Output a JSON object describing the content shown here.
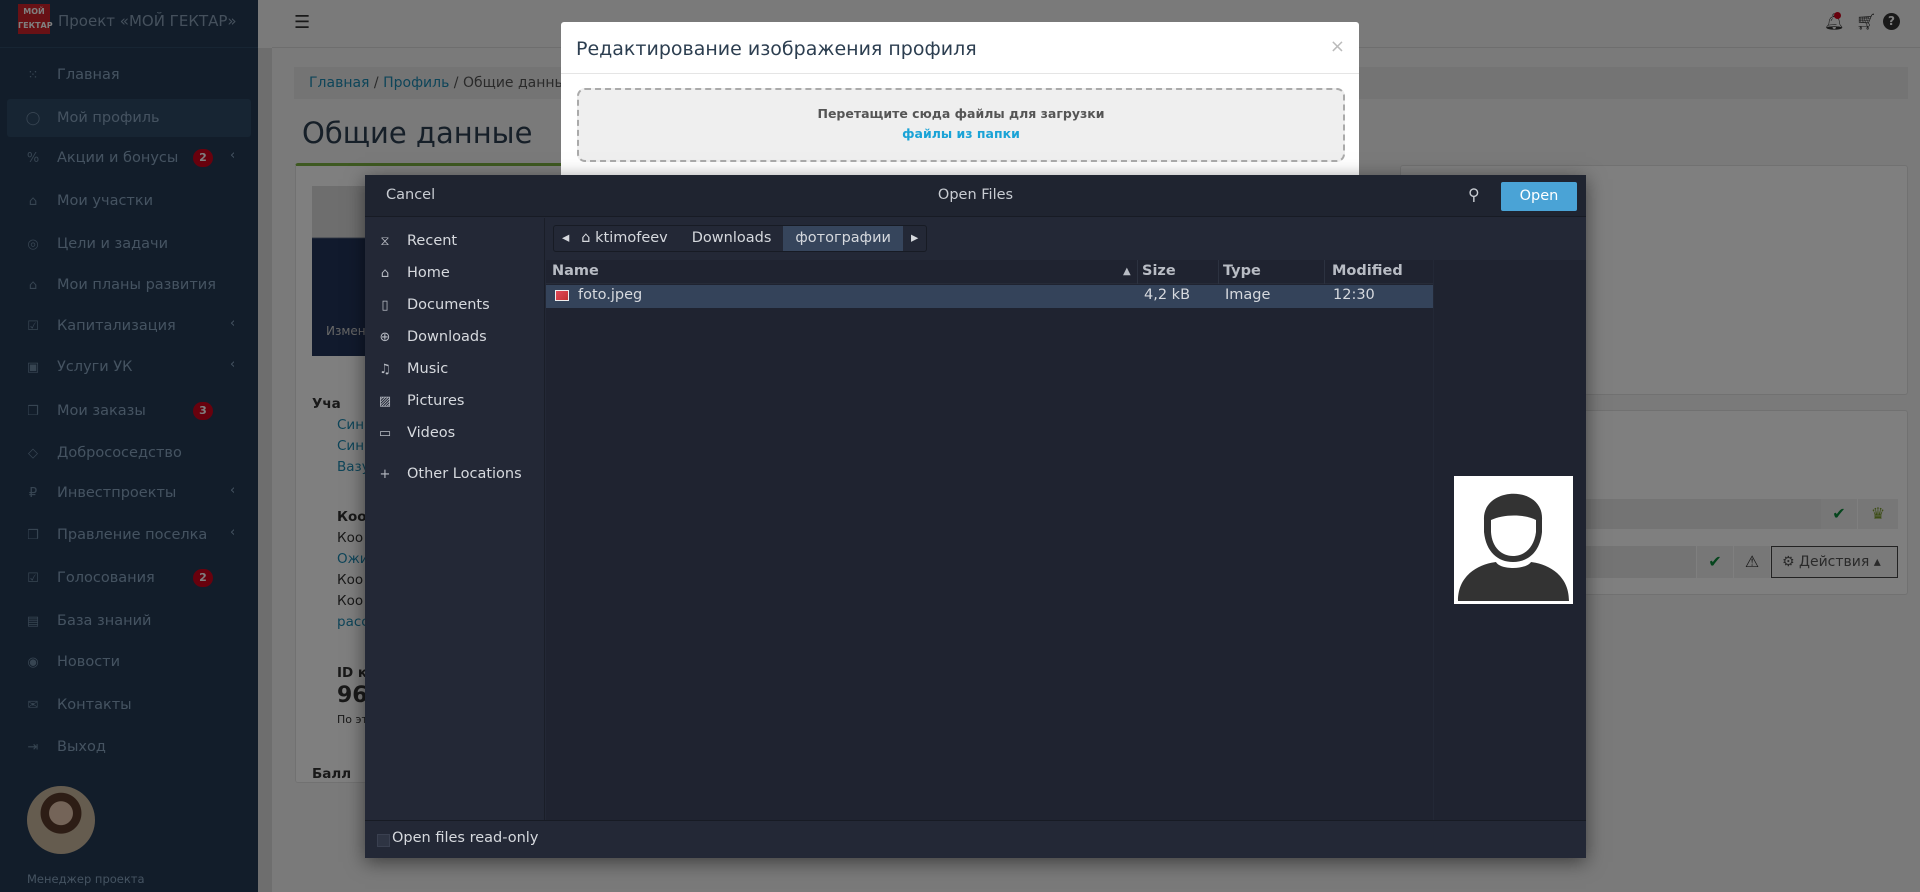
{
  "sidebar": {
    "logo_text": "МОЙ ГЕКТАР",
    "project_title": "Проект «МОЙ ГЕКТАР»",
    "items": [
      {
        "label": "Главная",
        "icon": "grid-icon"
      },
      {
        "label": "Мой профиль",
        "icon": "user-circle-icon",
        "active": true
      },
      {
        "label": "Акции и бонусы",
        "icon": "percent-icon",
        "badge": "2",
        "expandable": true
      },
      {
        "label": "Мои участки",
        "icon": "land-icon"
      },
      {
        "label": "Цели и задачи",
        "icon": "target-icon"
      },
      {
        "label": "Мои планы развития",
        "icon": "plan-icon"
      },
      {
        "label": "Капитализация",
        "icon": "chart-check-icon",
        "expandable": true
      },
      {
        "label": "Услуги УК",
        "icon": "briefcase-icon",
        "expandable": true
      },
      {
        "label": "Мои заказы",
        "icon": "boxes-icon",
        "badge": "3"
      },
      {
        "label": "Добрососедство",
        "icon": "handshake-icon"
      },
      {
        "label": "Инвестпроекты",
        "icon": "ruble-icon",
        "expandable": true
      },
      {
        "label": "Правление поселка",
        "icon": "boxes-icon",
        "expandable": true
      },
      {
        "label": "Голосования",
        "icon": "vote-icon",
        "badge": "2"
      },
      {
        "label": "База знаний",
        "icon": "book-icon"
      },
      {
        "label": "Новости",
        "icon": "news-icon"
      },
      {
        "label": "Контакты",
        "icon": "contacts-icon"
      },
      {
        "label": "Выход",
        "icon": "logout-icon"
      }
    ],
    "manager_label": "Менеджер проекта"
  },
  "topbar": {
    "icons": [
      "menu-icon",
      "bell-icon",
      "cart-icon",
      "help-icon"
    ]
  },
  "breadcrumb": {
    "home": "Главная",
    "profile": "Профиль",
    "current": "Общие данные"
  },
  "page_title": "Общие данные",
  "background": {
    "change_photo": "Измени",
    "plots_heading": "Уча",
    "plots": [
      "Син",
      "Син",
      "Вазу"
    ],
    "coop_heading": "Коо",
    "coop": [
      "Коо",
      "Ожи",
      "Коо",
      "Коо",
      "расс"
    ],
    "id_heading": "ID к",
    "id_value": "96",
    "id_note": "По эт",
    "points_heading": "Балл",
    "actions_label": "Действия"
  },
  "upload_modal": {
    "title": "Редактирование изображения профиля",
    "close": "×",
    "drop_text": "Перетащите сюда файлы для загрузки",
    "folder_link": "файлы из папки"
  },
  "file_dialog": {
    "cancel": "Cancel",
    "title": "Open Files",
    "open": "Open",
    "places": [
      {
        "label": "Recent",
        "icon": "hourglass-icon"
      },
      {
        "label": "Home",
        "icon": "home-icon"
      },
      {
        "label": "Documents",
        "icon": "document-icon"
      },
      {
        "label": "Downloads",
        "icon": "download-icon"
      },
      {
        "label": "Music",
        "icon": "music-icon"
      },
      {
        "label": "Pictures",
        "icon": "pictures-icon"
      },
      {
        "label": "Videos",
        "icon": "video-icon"
      },
      {
        "label": "Other Locations",
        "icon": "plus-icon"
      }
    ],
    "path": [
      "ktimofeev",
      "Downloads",
      "фотографии"
    ],
    "columns": {
      "name": "Name",
      "size": "Size",
      "type": "Type",
      "modified": "Modified"
    },
    "files": [
      {
        "name": "foto.jpeg",
        "size": "4,2 kB",
        "type": "Image",
        "modified": "12:30",
        "selected": true
      }
    ],
    "read_only_label": "Open files read-only",
    "read_only_checked": false
  },
  "colors": {
    "accent": "#4aa3d6",
    "badge": "#d0021b",
    "link": "#1aa3d6"
  }
}
